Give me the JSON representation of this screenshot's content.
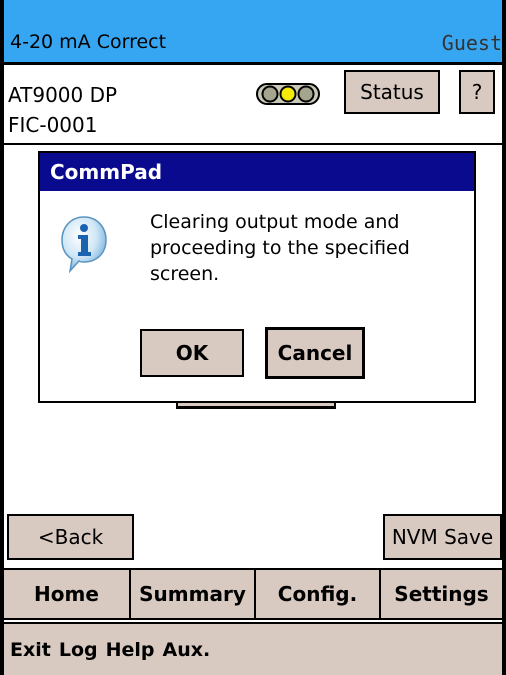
{
  "title_bar": {
    "left": "4-20 mA Correct",
    "right": "Guest"
  },
  "device": {
    "model": "AT9000 DP",
    "tag": "FIC-0001"
  },
  "header_buttons": {
    "status": "Status",
    "help": "?"
  },
  "dialog": {
    "title": "CommPad",
    "icon": "info-icon",
    "message": "Clearing output mode and proceeding to the specified screen.",
    "ok": "OK",
    "cancel": "Cancel"
  },
  "action_buttons": {
    "back": "<Back",
    "nvm_save": "NVM Save"
  },
  "nav_tabs": [
    "Home",
    "Summary",
    "Config.",
    "Settings"
  ],
  "bottom_menu": [
    "Exit",
    "Log",
    "Help",
    "Aux."
  ],
  "colors": {
    "title_bar": "#37a6f2",
    "dialog_title": "#0a0a8e",
    "button": "#d8c9c1",
    "traffic_light_active": "#f5e90a"
  }
}
